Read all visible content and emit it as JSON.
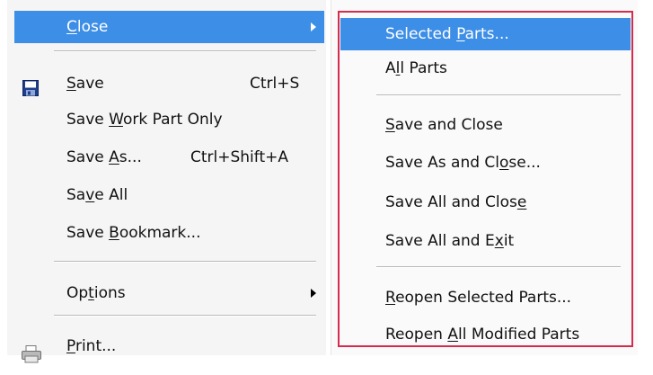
{
  "file_menu": {
    "close": {
      "before": "",
      "u": "C",
      "after": "lose"
    },
    "save": {
      "before": "",
      "u": "S",
      "after": "ave",
      "shortcut": "Ctrl+S"
    },
    "save_work_part_only": {
      "before": "Save ",
      "u": "W",
      "after": "ork Part Only"
    },
    "save_as": {
      "before": "Save ",
      "u": "A",
      "after": "s...",
      "shortcut": "Ctrl+Shift+A"
    },
    "save_all": {
      "before": "Sa",
      "u": "v",
      "after": "e All"
    },
    "save_bookmark": {
      "before": "Save ",
      "u": "B",
      "after": "ookmark..."
    },
    "options": {
      "before": "Op",
      "u": "t",
      "after": "ions"
    },
    "print": {
      "before": "",
      "u": "P",
      "after": "rint..."
    }
  },
  "close_submenu": {
    "selected_parts": {
      "before": "Selected ",
      "u": "P",
      "after": "arts..."
    },
    "all_parts": {
      "before": "A",
      "u": "l",
      "after": "l Parts"
    },
    "save_and_close": {
      "before": "",
      "u": "S",
      "after": "ave and Close"
    },
    "save_as_and_close": {
      "before": "Save As and Cl",
      "u": "o",
      "after": "se..."
    },
    "save_all_and_close": {
      "before": "Save All and Clos",
      "u": "e",
      "after": ""
    },
    "save_all_and_exit": {
      "before": "Save All and E",
      "u": "x",
      "after": "it"
    },
    "reopen_selected_parts": {
      "before": "",
      "u": "R",
      "after": "eopen Selected Parts..."
    },
    "reopen_all_modified_parts": {
      "before": "Reopen ",
      "u": "A",
      "after": "ll Modified Parts"
    }
  },
  "colors": {
    "highlight": "#3d8ee6",
    "annotation_box": "#d52b4e",
    "menu_bg": "#f5f5f5"
  },
  "icons": {
    "save": "floppy-disk-icon",
    "print": "printer-icon",
    "submenu": "submenu-arrow-icon"
  }
}
